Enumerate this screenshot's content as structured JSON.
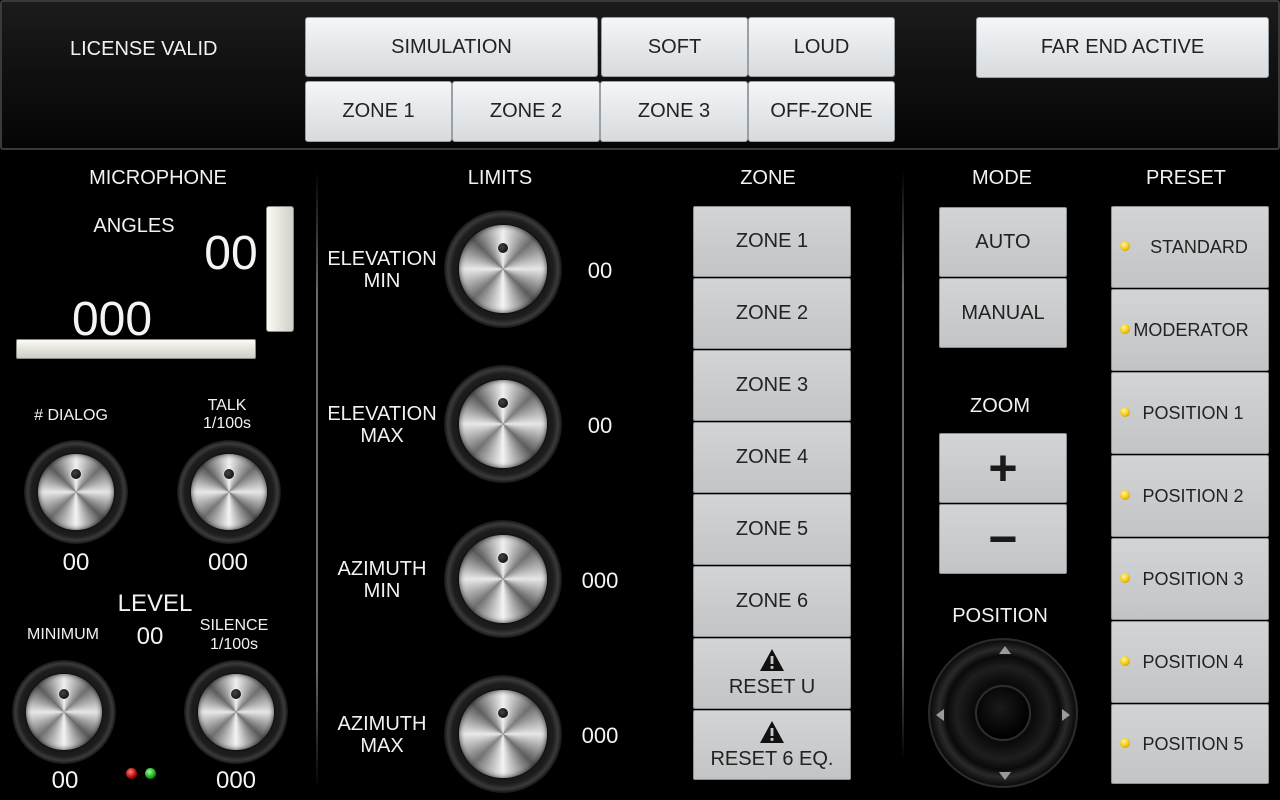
{
  "topbar": {
    "license": "LICENSE VALID",
    "simulation": "SIMULATION",
    "soft": "SOFT",
    "loud": "LOUD",
    "far_end": "FAR END ACTIVE",
    "zones": [
      "ZONE 1",
      "ZONE 2",
      "ZONE 3",
      "OFF-ZONE"
    ]
  },
  "microphone": {
    "title": "MICROPHONE",
    "angles_label": "ANGLES",
    "angle_vertical": "00",
    "angle_horizontal": "000",
    "dialog_label": "# DIALOG",
    "dialog_value": "00",
    "talk_label": "TALK",
    "talk_unit": "1/100s",
    "talk_value": "000",
    "level_label": "LEVEL",
    "level_value": "00",
    "minimum_label": "MINIMUM",
    "minimum_value": "00",
    "silence_label": "SILENCE",
    "silence_unit": "1/100s",
    "silence_value": "000"
  },
  "limits": {
    "title": "LIMITS",
    "items": [
      {
        "line1": "ELEVATION",
        "line2": "MIN",
        "value": "00"
      },
      {
        "line1": "ELEVATION",
        "line2": "MAX",
        "value": "00"
      },
      {
        "line1": "AZIMUTH",
        "line2": "MIN",
        "value": "000"
      },
      {
        "line1": "AZIMUTH",
        "line2": "MAX",
        "value": "000"
      }
    ]
  },
  "zone": {
    "title": "ZONE",
    "buttons": [
      "ZONE 1",
      "ZONE 2",
      "ZONE 3",
      "ZONE 4",
      "ZONE 5",
      "ZONE 6"
    ],
    "reset_u": "RESET U",
    "reset_6": "RESET 6 EQ."
  },
  "mode": {
    "title": "MODE",
    "auto": "AUTO",
    "manual": "MANUAL",
    "zoom_title": "ZOOM",
    "zoom_in": "+",
    "zoom_out": "−",
    "position_title": "POSITION"
  },
  "preset": {
    "title": "PRESET",
    "items": [
      "STANDARD",
      "MODERATOR",
      "POSITION 1",
      "POSITION 2",
      "POSITION 3",
      "POSITION 4",
      "POSITION 5"
    ]
  },
  "colors": {
    "background": "#000000",
    "button_light": "#e4e7ea",
    "button_zone": "#c8cacc",
    "led_red": "#cc0000",
    "led_green": "#18b018",
    "preset_led": "#f0c000"
  },
  "icons": {
    "knob": "rotary-knob",
    "warning": "warning-triangle-icon",
    "joystick": "dpad-joystick"
  }
}
